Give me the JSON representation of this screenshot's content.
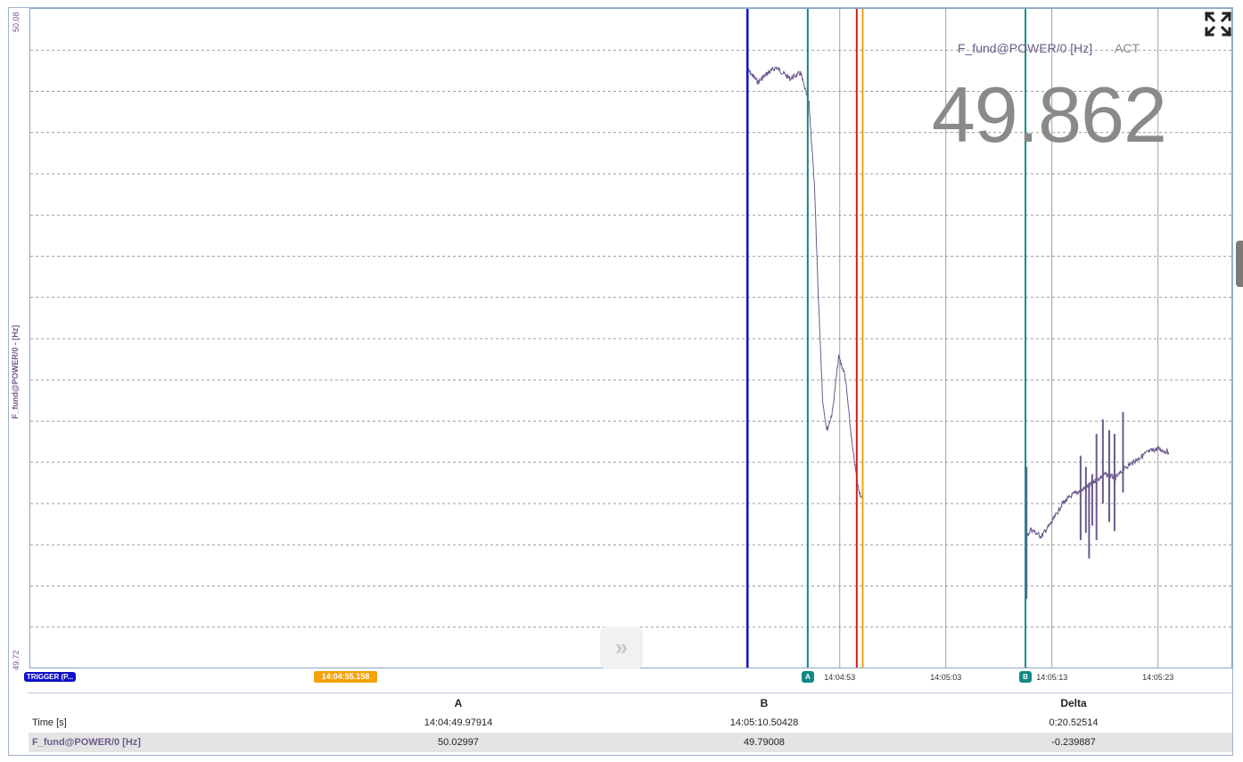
{
  "chart_data": {
    "type": "line",
    "title": "",
    "xlabel": "",
    "ylabel": "F_fund@POWER/0 - [Hz]",
    "ylim": [
      49.72,
      50.08
    ],
    "ytick_labels": [
      "50.08",
      "49.72"
    ],
    "xlim_seconds_of_day": [
      50616.7,
      50730.0
    ],
    "xticks": [
      {
        "label": "14:04:53",
        "t": "14:04:53"
      },
      {
        "label": "14:05:03",
        "t": "14:05:03"
      },
      {
        "label": "14:05:13",
        "t": "14:05:13"
      },
      {
        "label": "14:05:23",
        "t": "14:05:23"
      }
    ],
    "grid": true,
    "series": [
      {
        "name": "F_fund@POWER/0 [Hz]",
        "color": "#6b5b8c",
        "segments": [
          {
            "t": [
              "14:04:44.30",
              "14:04:45.30",
              "14:04:46.20",
              "14:04:47.00",
              "14:04:48.30",
              "14:04:49.30",
              "14:04:50.10",
              "14:04:50.60",
              "14:04:51.00",
              "14:04:51.40",
              "14:04:51.80",
              "14:04:52.30",
              "14:04:52.90",
              "14:04:53.50",
              "14:04:54.20",
              "14:04:54.70",
              "14:04:55.10",
              "14:04:55.16"
            ],
            "y": [
              50.047,
              50.04,
              50.045,
              50.048,
              50.042,
              50.045,
              50.028,
              49.985,
              49.92,
              49.865,
              49.85,
              49.86,
              49.89,
              49.88,
              49.84,
              49.82,
              49.812,
              49.81
            ]
          },
          {
            "t": [
              "14:05:10.50",
              "14:05:11.00",
              "14:05:12.00",
              "14:05:13.00",
              "14:05:14.00",
              "14:05:15.00",
              "14:05:16.00",
              "14:05:17.00",
              "14:05:18.00",
              "14:05:19.00",
              "14:05:20.00",
              "14:05:21.00",
              "14:05:22.00",
              "14:05:23.00",
              "14:05:24.00"
            ],
            "y": [
              49.79,
              49.796,
              49.792,
              49.8,
              49.81,
              49.815,
              49.818,
              49.822,
              49.826,
              49.824,
              49.83,
              49.834,
              49.838,
              49.84,
              49.838
            ]
          }
        ]
      }
    ],
    "spikes": [
      {
        "t": "14:05:10.60",
        "y_min": 49.758,
        "y_max": 49.83
      },
      {
        "t": "14:05:15.70",
        "y_min": 49.79,
        "y_max": 49.836
      },
      {
        "t": "14:05:16.20",
        "y_min": 49.794,
        "y_max": 49.83
      },
      {
        "t": "14:05:16.50",
        "y_min": 49.78,
        "y_max": 49.82
      },
      {
        "t": "14:05:16.80",
        "y_min": 49.798,
        "y_max": 49.826
      },
      {
        "t": "14:05:17.20",
        "y_min": 49.79,
        "y_max": 49.848
      },
      {
        "t": "14:05:17.80",
        "y_min": 49.81,
        "y_max": 49.856
      },
      {
        "t": "14:05:18.40",
        "y_min": 49.8,
        "y_max": 49.85
      },
      {
        "t": "14:05:18.90",
        "y_min": 49.795,
        "y_max": 49.848
      },
      {
        "t": "14:05:19.70",
        "y_min": 49.816,
        "y_max": 49.86
      }
    ],
    "cursors": [
      {
        "id": "trigger",
        "label": "TRIGGER (P...",
        "t": "14:04:44.30",
        "color": "#1010c8"
      },
      {
        "id": "A",
        "label": "A",
        "t": "14:04:49.97914",
        "color": "#0f8a86"
      },
      {
        "id": "red",
        "label": "",
        "t": "14:04:54.60",
        "color": "#cc1f1f"
      },
      {
        "id": "current",
        "label": "14:04:55.158",
        "t": "14:04:55.158",
        "color": "#f4a20a"
      },
      {
        "id": "B",
        "label": "B",
        "t": "14:05:10.50428",
        "color": "#0f8a86"
      }
    ]
  },
  "readout": {
    "channel": "F_fund@POWER/0 [Hz]",
    "mode": "ACT",
    "value": "49.862"
  },
  "icons": {
    "expand": "expand-icon",
    "fast_forward": "fast-forward-icon"
  },
  "cursor_table": {
    "headers": [
      "",
      "A",
      "B",
      "Delta"
    ],
    "rows": [
      {
        "label": "Time [s]",
        "a": "14:04:49.97914",
        "b": "14:05:10.50428",
        "delta": "0:20.52514"
      },
      {
        "label": "F_fund@POWER/0 [Hz]",
        "a": "50.02997",
        "b": "49.79008",
        "delta": "-0.239887"
      }
    ]
  }
}
